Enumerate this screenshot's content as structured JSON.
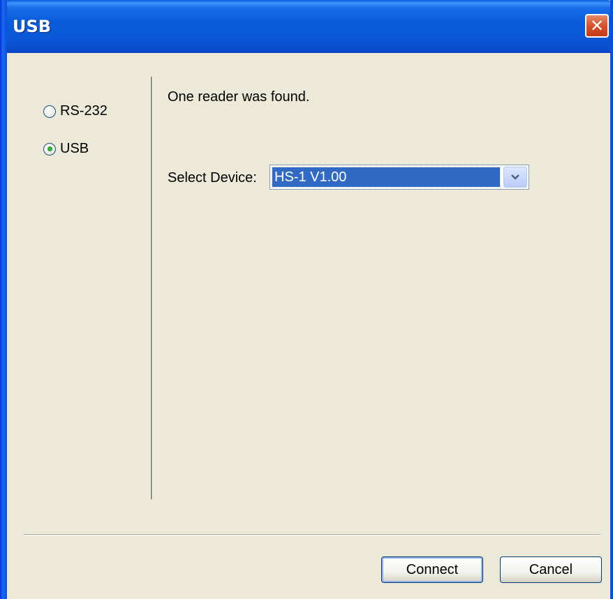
{
  "window": {
    "title": "USB",
    "close_label": "✕"
  },
  "connection_types": [
    {
      "label": "RS-232",
      "selected": false
    },
    {
      "label": "USB",
      "selected": true
    }
  ],
  "status": {
    "message": "One reader was found."
  },
  "device": {
    "label": "Select Device:",
    "selected_value": "HS-1 V1.00"
  },
  "buttons": {
    "connect_label": "Connect",
    "cancel_label": "Cancel"
  },
  "icons": {
    "close": "close-icon",
    "dropdown": "chevron-down-icon"
  },
  "colors": {
    "titlebar": "#0a58d8",
    "selection": "#316ac5",
    "background": "#ece9d8",
    "close": "#d9502a"
  }
}
